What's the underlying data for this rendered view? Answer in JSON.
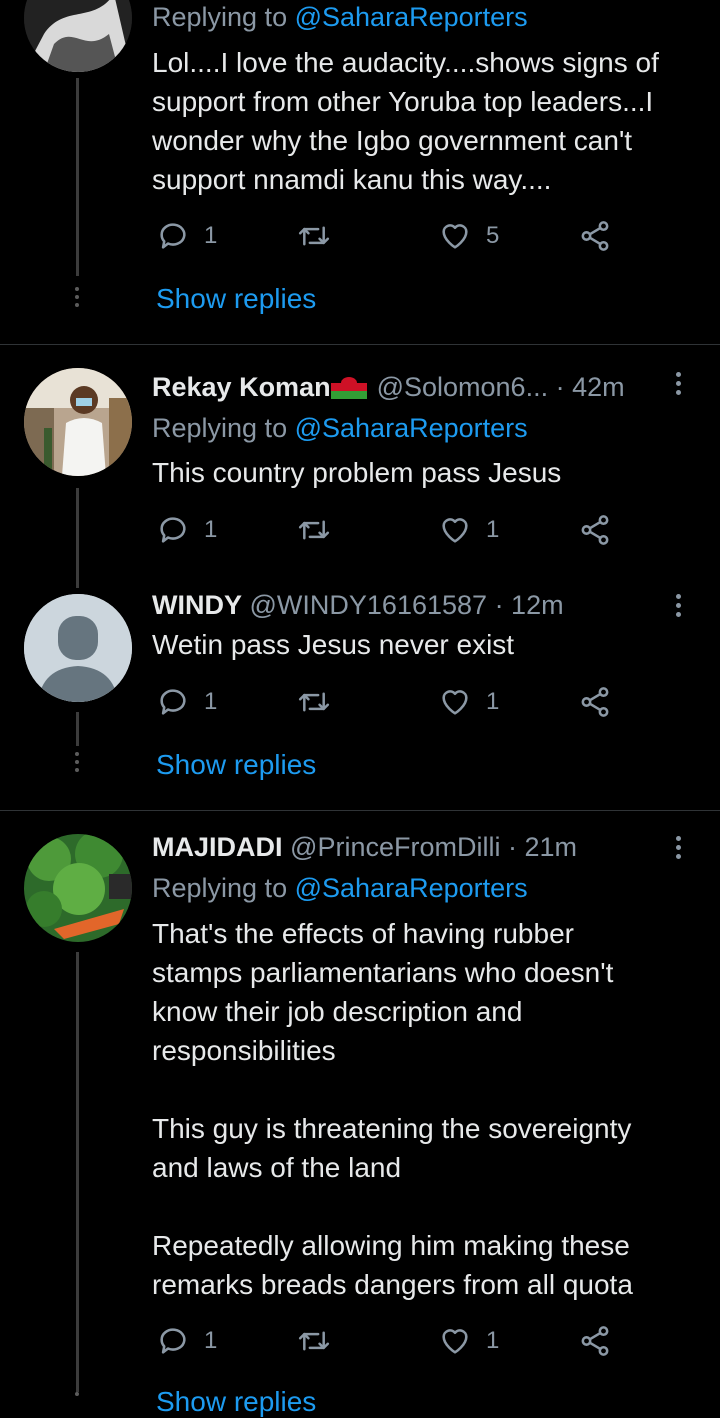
{
  "tweet1": {
    "replying_prefix": "Replying to",
    "replying_handle": "@SaharaReporters",
    "lines": [
      "Lol....I love the audacity....shows signs of",
      "support from other Yoruba top leaders...I",
      "wonder why the Igbo government can't",
      "support nnamdi kanu this way...."
    ],
    "reply_count": "1",
    "like_count": "5",
    "show_replies": "Show replies"
  },
  "tweet2": {
    "name": "Rekay Koman",
    "handle": "@Solomon6...",
    "time": "· 42m",
    "flag_colors": [
      "#ce1126",
      "#000000",
      "#339e35"
    ],
    "replying_prefix": "Replying to",
    "replying_handle": "@SaharaReporters",
    "text": "This country problem pass Jesus",
    "reply_count": "1",
    "like_count": "1"
  },
  "tweet3": {
    "name": "WINDY",
    "handle": "@WINDY16161587",
    "time": "· 12m",
    "text": "Wetin pass Jesus never exist",
    "reply_count": "1",
    "like_count": "1",
    "show_replies": "Show replies"
  },
  "tweet4": {
    "name": "MAJIDADI",
    "handle": "@PrinceFromDilli",
    "time": "· 21m",
    "replying_prefix": "Replying to",
    "replying_handle": "@SaharaReporters",
    "para1": [
      "That's the effects of having rubber",
      "stamps parliamentarians who doesn't",
      "know their job description and",
      "responsibilities"
    ],
    "para2": [
      "This guy is threatening the sovereignty",
      "and laws of the land"
    ],
    "para3": [
      "Repeatedly allowing him making these",
      "remarks breads dangers from all quota"
    ],
    "reply_count": "1",
    "like_count": "1",
    "show_replies": "Show replies"
  },
  "icons": [
    "reply-icon",
    "retweet-icon",
    "like-icon",
    "share-icon",
    "more-icon"
  ],
  "colors": {
    "background": "#000000",
    "link": "#1d9bf0",
    "muted": "#8b98a5",
    "text": "#e7e9ea"
  }
}
